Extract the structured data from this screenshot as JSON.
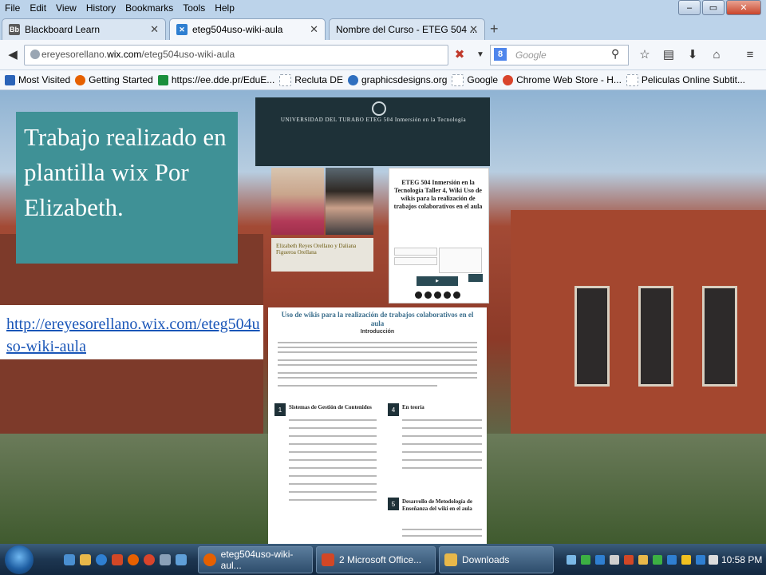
{
  "browser": {
    "menu": [
      "File",
      "Edit",
      "View",
      "History",
      "Bookmarks",
      "Tools",
      "Help"
    ],
    "tabs": [
      {
        "label": "Blackboard Learn",
        "favicon": "blackboard-icon",
        "color": "#5a5a5a"
      },
      {
        "label": "eteg504uso-wiki-aula",
        "favicon": "wix-icon",
        "color": "#2f7fd1"
      },
      {
        "label": "Nombre del Curso - ETEG 504 ...",
        "favicon": "page-icon",
        "color": "#9aa6b3"
      }
    ],
    "new_tab": "+",
    "url_domain": "ereyesorellano.",
    "url_host": "wix.com",
    "url_path": "/eteg504uso-wiki-aula",
    "search_placeholder": "Google",
    "bookmarks": [
      {
        "label": "Most Visited",
        "color": "#2a63b8"
      },
      {
        "label": "Getting Started",
        "color": "#e66000"
      },
      {
        "label": "https://ee.dde.pr/EduE...",
        "color": "#1a8f3c"
      },
      {
        "label": "Recluta DE",
        "color": "#9aa6b3"
      },
      {
        "label": "graphicsdesigns.org",
        "color": "#2f6fbf"
      },
      {
        "label": "Google",
        "color": "#9aa6b3"
      },
      {
        "label": "Chrome Web Store - H...",
        "color": "#d9442b"
      },
      {
        "label": "Peliculas Online Subtit...",
        "color": "#9aa6b3"
      }
    ]
  },
  "slide": {
    "title": "Trabajo realizado en plantilla wix Por  Elizabeth.",
    "link": "http://ereyesorellano.wix.com/eteg504uso-wiki-aula"
  },
  "wix_page": {
    "org": "UNIVERSIDAD DEL TURABO ETEG 504 Inmersión en la Tecnología",
    "authors": "Elizabeth Reyes Orellano y Daliana Figueroa Orellana",
    "course_card": "ETEG 504 Inmersión en la Tecnología Taller 4, Wiki Uso de wikis para la realización de trabajos colaborativos en el aula",
    "article_title": "Uso de wikis para la realización de trabajos colaborativos en el aula",
    "article_subtitle": "Introducción",
    "sections": [
      {
        "num": "1",
        "title": "Sistemas de Gestión de Contenidos"
      },
      {
        "num": "4",
        "title": "En teoría"
      },
      {
        "num": "5",
        "title": "Desarrollo de Metodología de Enseñanza del wiki en el aula"
      }
    ]
  },
  "taskbar": {
    "tasks": [
      {
        "label": "eteg504uso-wiki-aul...",
        "color": "#e66000"
      },
      {
        "label": "2 Microsoft Office...",
        "color": "#d24726"
      },
      {
        "label": "Downloads",
        "color": "#e8b84a"
      }
    ],
    "clock": "10:58 PM"
  }
}
